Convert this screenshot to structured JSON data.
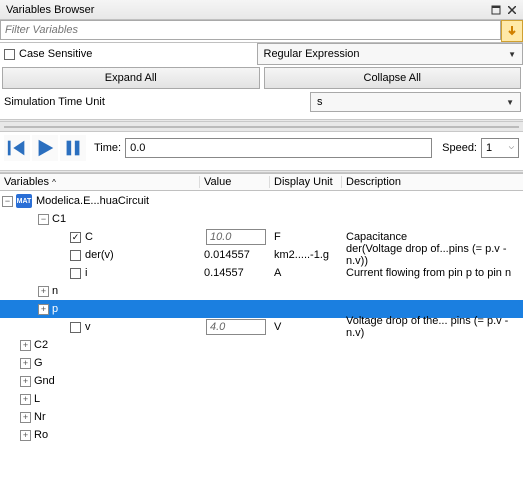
{
  "title": "Variables Browser",
  "filter_placeholder": "Filter Variables",
  "options": {
    "case_sensitive_label": "Case Sensitive",
    "match_mode": "Regular Expression"
  },
  "buttons": {
    "expand_all": "Expand All",
    "collapse_all": "Collapse All"
  },
  "sim_time_unit": {
    "label": "Simulation Time Unit",
    "value": "s"
  },
  "playback": {
    "time_label": "Time:",
    "time_value": "0.0",
    "speed_label": "Speed:",
    "speed_value": "1"
  },
  "columns": {
    "var": "Variables",
    "val": "Value",
    "du": "Display Unit",
    "desc": "Description"
  },
  "tree": {
    "root": "Modelica.E...huaCircuit",
    "items": [
      {
        "name": "C1",
        "expanded": true,
        "children": [
          {
            "name": "C",
            "checked": true,
            "value": "10.0",
            "editable": true,
            "unit": "F",
            "desc": "Capacitance"
          },
          {
            "name": "der(v)",
            "checked": false,
            "value": "0.014557",
            "editable": false,
            "unit": "km2.....-1.g",
            "desc": "der(Voltage drop of...pins (= p.v - n.v))"
          },
          {
            "name": "i",
            "checked": false,
            "value": "0.14557",
            "editable": false,
            "unit": "A",
            "desc": "Current flowing from pin p to pin n"
          },
          {
            "name": "n",
            "expandable": true
          },
          {
            "name": "p",
            "expandable": true,
            "selected": true
          },
          {
            "name": "v",
            "checked": false,
            "value": "4.0",
            "editable": true,
            "unit": "V",
            "desc": "Voltage drop of the... pins (= p.v - n.v)"
          }
        ]
      },
      {
        "name": "C2"
      },
      {
        "name": "G"
      },
      {
        "name": "Gnd"
      },
      {
        "name": "L"
      },
      {
        "name": "Nr"
      },
      {
        "name": "Ro"
      }
    ]
  }
}
